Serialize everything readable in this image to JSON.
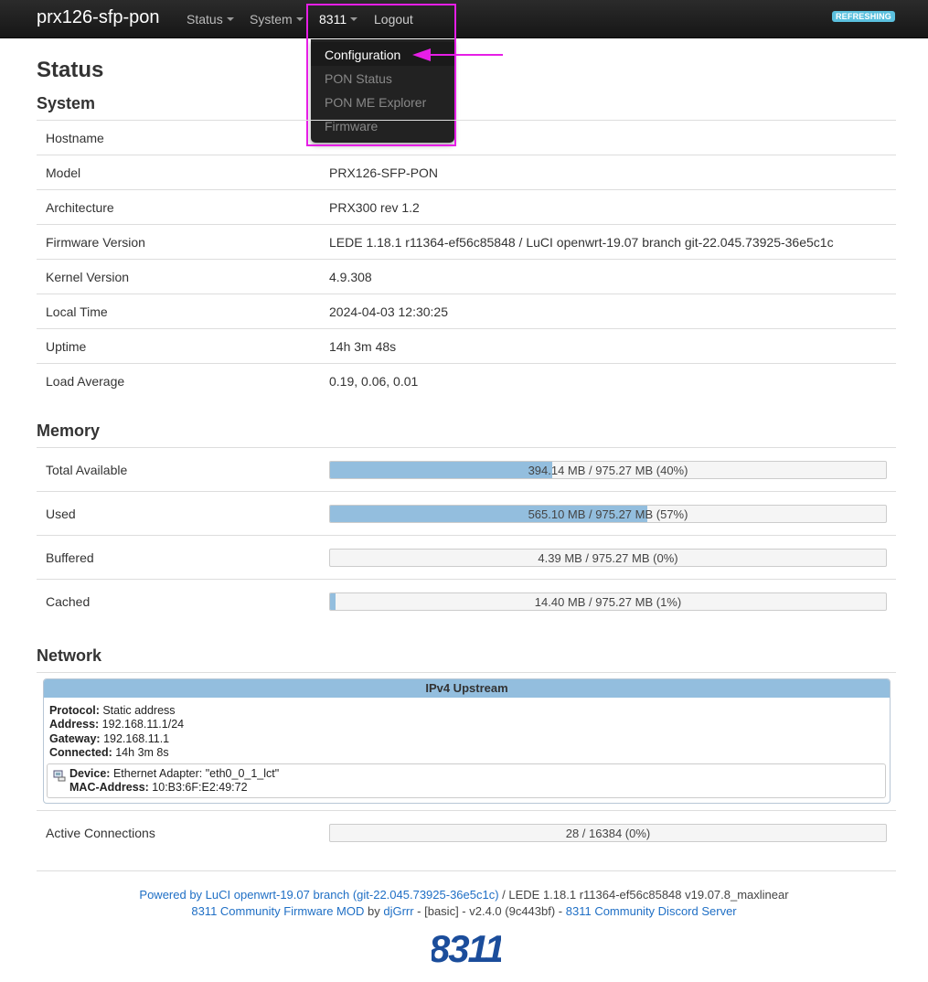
{
  "nav": {
    "brand": "prx126-sfp-pon",
    "status": "Status",
    "system": "System",
    "menu_8311": "8311",
    "logout": "Logout",
    "badge": "REFRESHING",
    "dropdown": [
      "Configuration",
      "PON Status",
      "PON ME Explorer",
      "Firmware"
    ]
  },
  "page_title": "Status",
  "system": {
    "title": "System",
    "rows": [
      {
        "label": "Hostname",
        "value": ""
      },
      {
        "label": "Model",
        "value": "PRX126-SFP-PON"
      },
      {
        "label": "Architecture",
        "value": "PRX300 rev 1.2"
      },
      {
        "label": "Firmware Version",
        "value": "LEDE 1.18.1 r11364-ef56c85848 / LuCI openwrt-19.07 branch git-22.045.73925-36e5c1c"
      },
      {
        "label": "Kernel Version",
        "value": "4.9.308"
      },
      {
        "label": "Local Time",
        "value": "2024-04-03 12:30:25"
      },
      {
        "label": "Uptime",
        "value": "14h 3m 48s"
      },
      {
        "label": "Load Average",
        "value": "0.19, 0.06, 0.01"
      }
    ]
  },
  "memory": {
    "title": "Memory",
    "rows": [
      {
        "label": "Total Available",
        "text": "394.14 MB / 975.27 MB (40%)",
        "fraction": 0.4
      },
      {
        "label": "Used",
        "text": "565.10 MB / 975.27 MB (57%)",
        "fraction": 0.57
      },
      {
        "label": "Buffered",
        "text": "4.39 MB / 975.27 MB (0%)",
        "fraction": 0.0
      },
      {
        "label": "Cached",
        "text": "14.40 MB / 975.27 MB (1%)",
        "fraction": 0.01
      }
    ]
  },
  "network": {
    "title": "Network",
    "upstream_title": "IPv4 Upstream",
    "protocol_label": "Protocol:",
    "protocol": "Static address",
    "address_label": "Address:",
    "address": "192.168.11.1/24",
    "gateway_label": "Gateway:",
    "gateway": "192.168.11.1",
    "connected_label": "Connected:",
    "connected": "14h 3m 8s",
    "device_label": "Device:",
    "device": "Ethernet Adapter: \"eth0_0_1_lct\"",
    "mac_label": "MAC-Address:",
    "mac": "10:B3:6F:E2:49:72",
    "active_label": "Active Connections",
    "active_text": "28 / 16384 (0%)",
    "active_fraction": 0.0
  },
  "footer": {
    "powered": "Powered by LuCI openwrt-19.07 branch (git-22.045.73925-36e5c1c)",
    "lede": " / LEDE 1.18.1 r11364-ef56c85848 v19.07.8_maxlinear",
    "mod": "8311 Community Firmware MOD",
    "by": " by ",
    "author": "djGrrr",
    "version": " - [basic] - v2.4.0 (9c443bf) - ",
    "discord": "8311 Community Discord Server",
    "logo": "8311"
  },
  "colors": {
    "accent": "#93bede",
    "highlight": "#e61ee6",
    "link": "#1f6fc5"
  }
}
